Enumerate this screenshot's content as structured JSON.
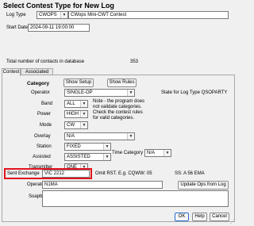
{
  "window": {
    "title": "Select Contest Type for New Log"
  },
  "log_type": {
    "label": "Log Type",
    "value": "CWOPS",
    "description": "CWops Mini-CWT Contest"
  },
  "start_date": {
    "label": "Start Date",
    "value": "2024-09-11 19:00:00"
  },
  "contacts": {
    "label": "Total number of contacts in database",
    "value": "353"
  },
  "tabs": [
    {
      "label": "Contest"
    },
    {
      "label": "Associated Files"
    }
  ],
  "category": {
    "heading": "Category",
    "show_setup_label": "Show Setup",
    "show_rules_label": "Show Rules",
    "state_text": "State for Log Type QSOPARTY",
    "operator": {
      "label": "Operator",
      "value": "SINGLE-OP"
    },
    "band": {
      "label": "Band",
      "value": "ALL"
    },
    "power": {
      "label": "Power",
      "value": "HIGH"
    },
    "mode": {
      "label": "Mode",
      "value": "CW"
    },
    "overlay": {
      "label": "Overlay",
      "value": "N/A"
    },
    "station": {
      "label": "Station",
      "value": "FIXED"
    },
    "assisted": {
      "label": "Assisted",
      "value": "ASSISTED"
    },
    "time_category": {
      "label": "Time Category",
      "value": "N/A"
    },
    "transmitter": {
      "label": "Transmitter",
      "value": "ONE"
    },
    "note": [
      "Note - the program does",
      "not validate categories.",
      "Check the contest rules",
      "for valid categories."
    ]
  },
  "sent_exchange": {
    "label": "Sent Exchange",
    "value": "VIC 2212",
    "hint": "Omit RST. E.g. CQWW: 05",
    "hint2": "SS: A 56 EMA"
  },
  "operators": {
    "label": "Operators",
    "value": "N1MA",
    "update_button_label": "Update Ops from Log"
  },
  "soapbox": {
    "label": "Soapbox",
    "value": ""
  },
  "footer": {
    "ok_label": "OK",
    "help_label": "Help",
    "cancel_label": "Cancel"
  },
  "colors": {
    "highlight_box": "#e0141e"
  }
}
